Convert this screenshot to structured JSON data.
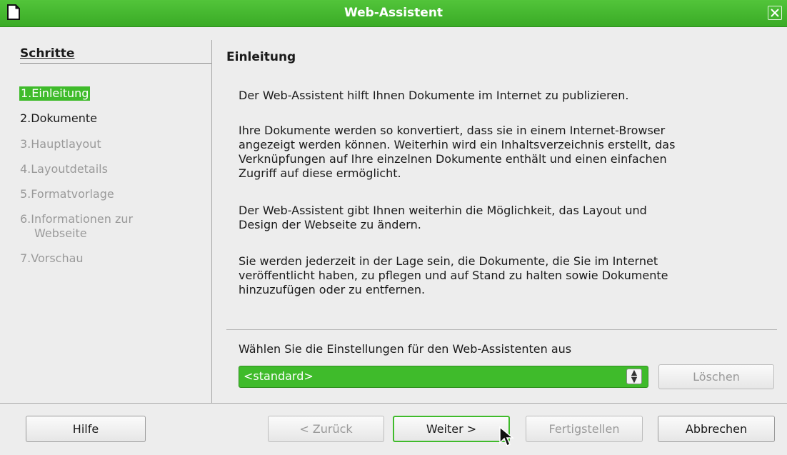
{
  "window": {
    "title": "Web-Assistent"
  },
  "steps": {
    "heading": "Schritte",
    "items": [
      {
        "label": "1.Einleitung"
      },
      {
        "label": "2.Dokumente"
      },
      {
        "label": "3.Hauptlayout"
      },
      {
        "label": "4.Layoutdetails"
      },
      {
        "label": "5.Formatvorlage"
      },
      {
        "label": "6.Informationen zur"
      },
      {
        "label": "Webseite"
      },
      {
        "label": "7.Vorschau"
      }
    ]
  },
  "page": {
    "title": "Einleitung",
    "paragraphs": [
      "Der Web-Assistent hilft Ihnen Dokumente im Internet zu publizieren.",
      "Ihre Dokumente werden so konvertiert, dass sie in einem Internet-Browser",
      "angezeigt werden können. Weiterhin wird ein Inhaltsverzeichnis erstellt, das",
      "Verknüpfungen auf Ihre einzelnen Dokumente enthält und einen einfachen",
      "Zugriff auf diese ermöglicht.",
      "Der Web-Assistent gibt Ihnen weiterhin die Möglichkeit, das Layout und",
      "Design der Webseite zu ändern.",
      "Sie werden jederzeit in der Lage sein, die Dokumente, die Sie im Internet",
      "veröffentlicht haben, zu pflegen und auf Stand zu halten sowie Dokumente",
      "hinzuzufügen oder zu entfernen."
    ],
    "settings_label": "Wählen Sie die Einstellungen für den Web-Assistenten aus",
    "settings_value": "<standard>",
    "delete_label": "Löschen"
  },
  "buttons": {
    "help": "Hilfe",
    "back": "< Zurück",
    "next": "Weiter >",
    "finish": "Fertigstellen",
    "cancel": "Abbrechen"
  },
  "colors": {
    "accent": "#3fbb2b",
    "titlebar": "#46b930"
  },
  "icons": {
    "app": "document-icon",
    "close": "close-icon",
    "spin": "spin-updown-icon",
    "cursor": "mouse-pointer-icon"
  }
}
